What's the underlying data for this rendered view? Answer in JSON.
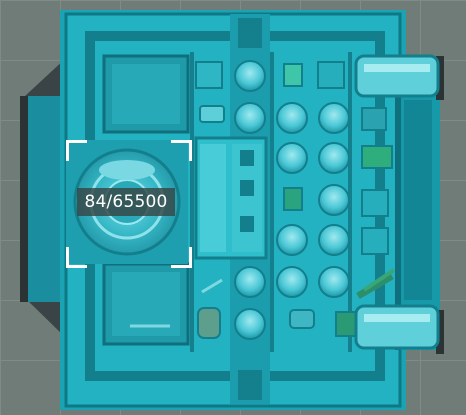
{
  "selection": {
    "label": "84/65500"
  },
  "scene": {
    "tint": "#1fb3c4",
    "ground": "#6f7c78",
    "wall": "#1796a6",
    "floor": "#2fc7d3",
    "panel_dark": "#0f6f7c"
  },
  "ship_icons": [
    "engine-pod-icon",
    "cryo-pod-icon",
    "crate-icon",
    "pipe-icon",
    "tank-icon"
  ]
}
